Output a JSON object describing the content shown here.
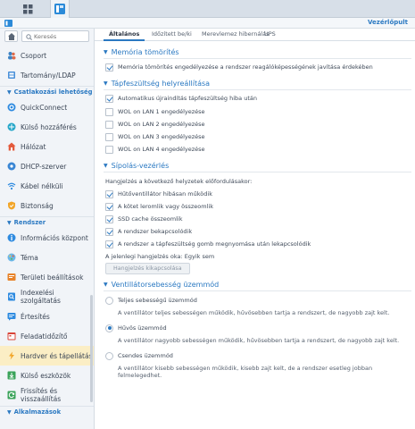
{
  "window": {
    "title": "Vezérlőpult"
  },
  "sidebar": {
    "search_placeholder": "Keresés",
    "items": [
      {
        "label": "Csoport",
        "icon": "group-icon"
      },
      {
        "label": "Tartomány/LDAP",
        "icon": "domain-icon"
      }
    ],
    "section_connectivity": "Csatlakozási lehetőség",
    "connectivity": [
      {
        "label": "QuickConnect",
        "icon": "quickconnect-icon"
      },
      {
        "label": "Külső hozzáférés",
        "icon": "external-access-icon"
      },
      {
        "label": "Hálózat",
        "icon": "network-icon"
      },
      {
        "label": "DHCP-szerver",
        "icon": "dhcp-icon"
      },
      {
        "label": "Kábel nélküli",
        "icon": "wireless-icon"
      },
      {
        "label": "Biztonság",
        "icon": "security-icon"
      }
    ],
    "section_system": "Rendszer",
    "system": [
      {
        "label": "Információs központ",
        "icon": "info-icon"
      },
      {
        "label": "Téma",
        "icon": "theme-icon"
      },
      {
        "label": "Területi beállítások",
        "icon": "regional-icon"
      },
      {
        "label": "Indexelési szolgáltatás",
        "icon": "indexing-icon"
      },
      {
        "label": "Értesítés",
        "icon": "notification-icon"
      },
      {
        "label": "Feladatidőzítő",
        "icon": "task-scheduler-icon"
      },
      {
        "label": "Hardver és tápellátás",
        "icon": "hardware-icon"
      },
      {
        "label": "Külső eszközök",
        "icon": "external-devices-icon"
      },
      {
        "label": "Frissítés és visszaállítás",
        "icon": "update-icon"
      }
    ],
    "section_apps": "Alkalmazások"
  },
  "tabs": [
    "Általános",
    "Időzített be/ki",
    "Merevlemez hibernálás",
    "UPS"
  ],
  "memory": {
    "title": "Memória tömörítés",
    "option": "Memória tömörítés engedélyezése a rendszer reagálóképességének javítása érdekében"
  },
  "power_recovery": {
    "title": "Tápfeszültség helyreállítása",
    "options": [
      "Automatikus újraindítás tápfeszültség hiba után",
      "WOL on LAN 1 engedélyezése",
      "WOL on LAN 2 engedélyezése",
      "WOL on LAN 3 engedélyezése",
      "WOL on LAN 4 engedélyezése"
    ]
  },
  "beep": {
    "title": "Sípolás-vezérlés",
    "intro": "Hangjelzés a következő helyzetek előfordulásakor:",
    "options": [
      "Hűtőventillátor hibásan működik",
      "A kötet leromlik vagy összeomlik",
      "SSD cache összeomlik",
      "A rendszer bekapcsolódik",
      "A rendszer a tápfeszültség gomb megnyomása után lekapcsolódik"
    ],
    "current_reason": "A jelenlegi hangjelzés oka: Egyik sem",
    "mute_button": "Hangjelzés kikapcsolása"
  },
  "fan": {
    "title": "Ventillátorsebesség üzemmód",
    "modes": [
      {
        "label": "Teljes sebességű üzemmód",
        "desc": "A ventillátor teljes sebességen működik, hűvösebben tartja a rendszert, de nagyobb zajt kelt."
      },
      {
        "label": "Hűvös üzemmód",
        "desc": "A ventillátor nagyobb sebességen működik, hűvösebben tartja a rendszert, de nagyobb zajt kelt."
      },
      {
        "label": "Csendes üzemmód",
        "desc": "A ventillátor kisebb sebességen működik, kisebb zajt kelt, de a rendszer esetleg jobban felmelegedhet."
      }
    ]
  },
  "colors": {
    "accent": "#2b79c2",
    "active_bg": "#fbeec5"
  }
}
